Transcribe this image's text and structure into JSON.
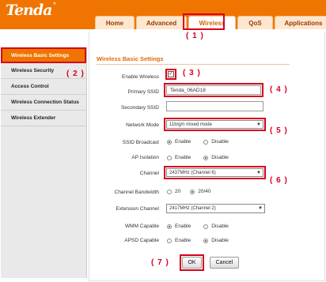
{
  "brand": {
    "logo": "Tenda",
    "trademark": "®"
  },
  "tabs": [
    "Home",
    "Advanced",
    "Wireless",
    "QoS",
    "Applications"
  ],
  "annotations": [
    "( 1 )",
    "( 2 )",
    "( 3 )",
    "( 4 )",
    "( 5 )",
    "( 6 )",
    "( 7 )"
  ],
  "sidebar": {
    "items": [
      "Wireless Basic Settings",
      "Wireless Security",
      "Access Control",
      "Wireless Connection Status",
      "Wireless Extender"
    ]
  },
  "section_title": "Wireless Basic Settings",
  "form": {
    "enable_wireless": {
      "label": "Enable Wireless",
      "checked": true
    },
    "primary_ssid": {
      "label": "Primary SSID",
      "value": "Tenda_06AD18"
    },
    "secondary_ssid": {
      "label": "Secondary SSID",
      "value": ""
    },
    "network_mode": {
      "label": "Network Mode",
      "value": "11b/g/n mixed mode"
    },
    "ssid_broadcast": {
      "label": "SSID Broadcast",
      "options": [
        "Enable",
        "Disable"
      ],
      "selected": "Enable"
    },
    "ap_isolation": {
      "label": "AP Isolation",
      "options": [
        "Enable",
        "Disable"
      ],
      "selected": "Disable"
    },
    "channel": {
      "label": "Channel",
      "value": "2437MHz (Channel 6)"
    },
    "channel_bandwidth": {
      "label": "Channel Bandwidth",
      "options": [
        "20",
        "20/40"
      ],
      "selected": "20/40"
    },
    "extension_channel": {
      "label": "Extension Channel",
      "value": "2417MHz (Channel 2)"
    },
    "wmm_capable": {
      "label": "WMM Capable",
      "options": [
        "Enable",
        "Disable"
      ],
      "selected": "Enable"
    },
    "apsd_capable": {
      "label": "APSD Capable",
      "options": [
        "Enable",
        "Disable"
      ],
      "selected": "Disable"
    }
  },
  "buttons": {
    "ok": "OK",
    "cancel": "Cancel"
  },
  "colors": {
    "header": "#f07400",
    "highlight": "#d6001c",
    "title": "#e06a00"
  }
}
